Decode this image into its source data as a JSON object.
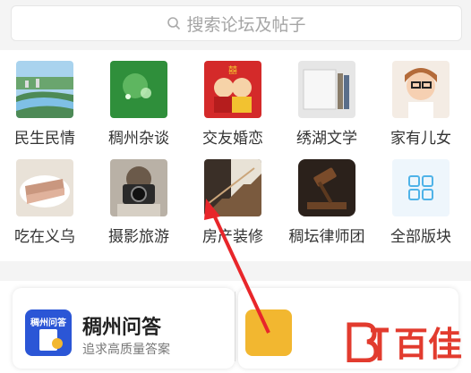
{
  "search": {
    "placeholder": "搜索论坛及帖子"
  },
  "forums": [
    {
      "label": "民生民情"
    },
    {
      "label": "稠州杂谈"
    },
    {
      "label": "交友婚恋"
    },
    {
      "label": "绣湖文学"
    },
    {
      "label": "家有儿女"
    },
    {
      "label": "吃在义乌"
    },
    {
      "label": "摄影旅游"
    },
    {
      "label": "房产装修"
    },
    {
      "label": "稠坛律师团"
    },
    {
      "label": "全部版块"
    }
  ],
  "qa_card": {
    "title": "稠州问答",
    "subtitle": "追求高质量答案",
    "icon_text": "稠州问答"
  },
  "watermark": {
    "text": "百佳"
  },
  "colors": {
    "accent": "#e23b2e",
    "qa_blue": "#2b56d6",
    "grid_icon": "#4fb3e8"
  }
}
